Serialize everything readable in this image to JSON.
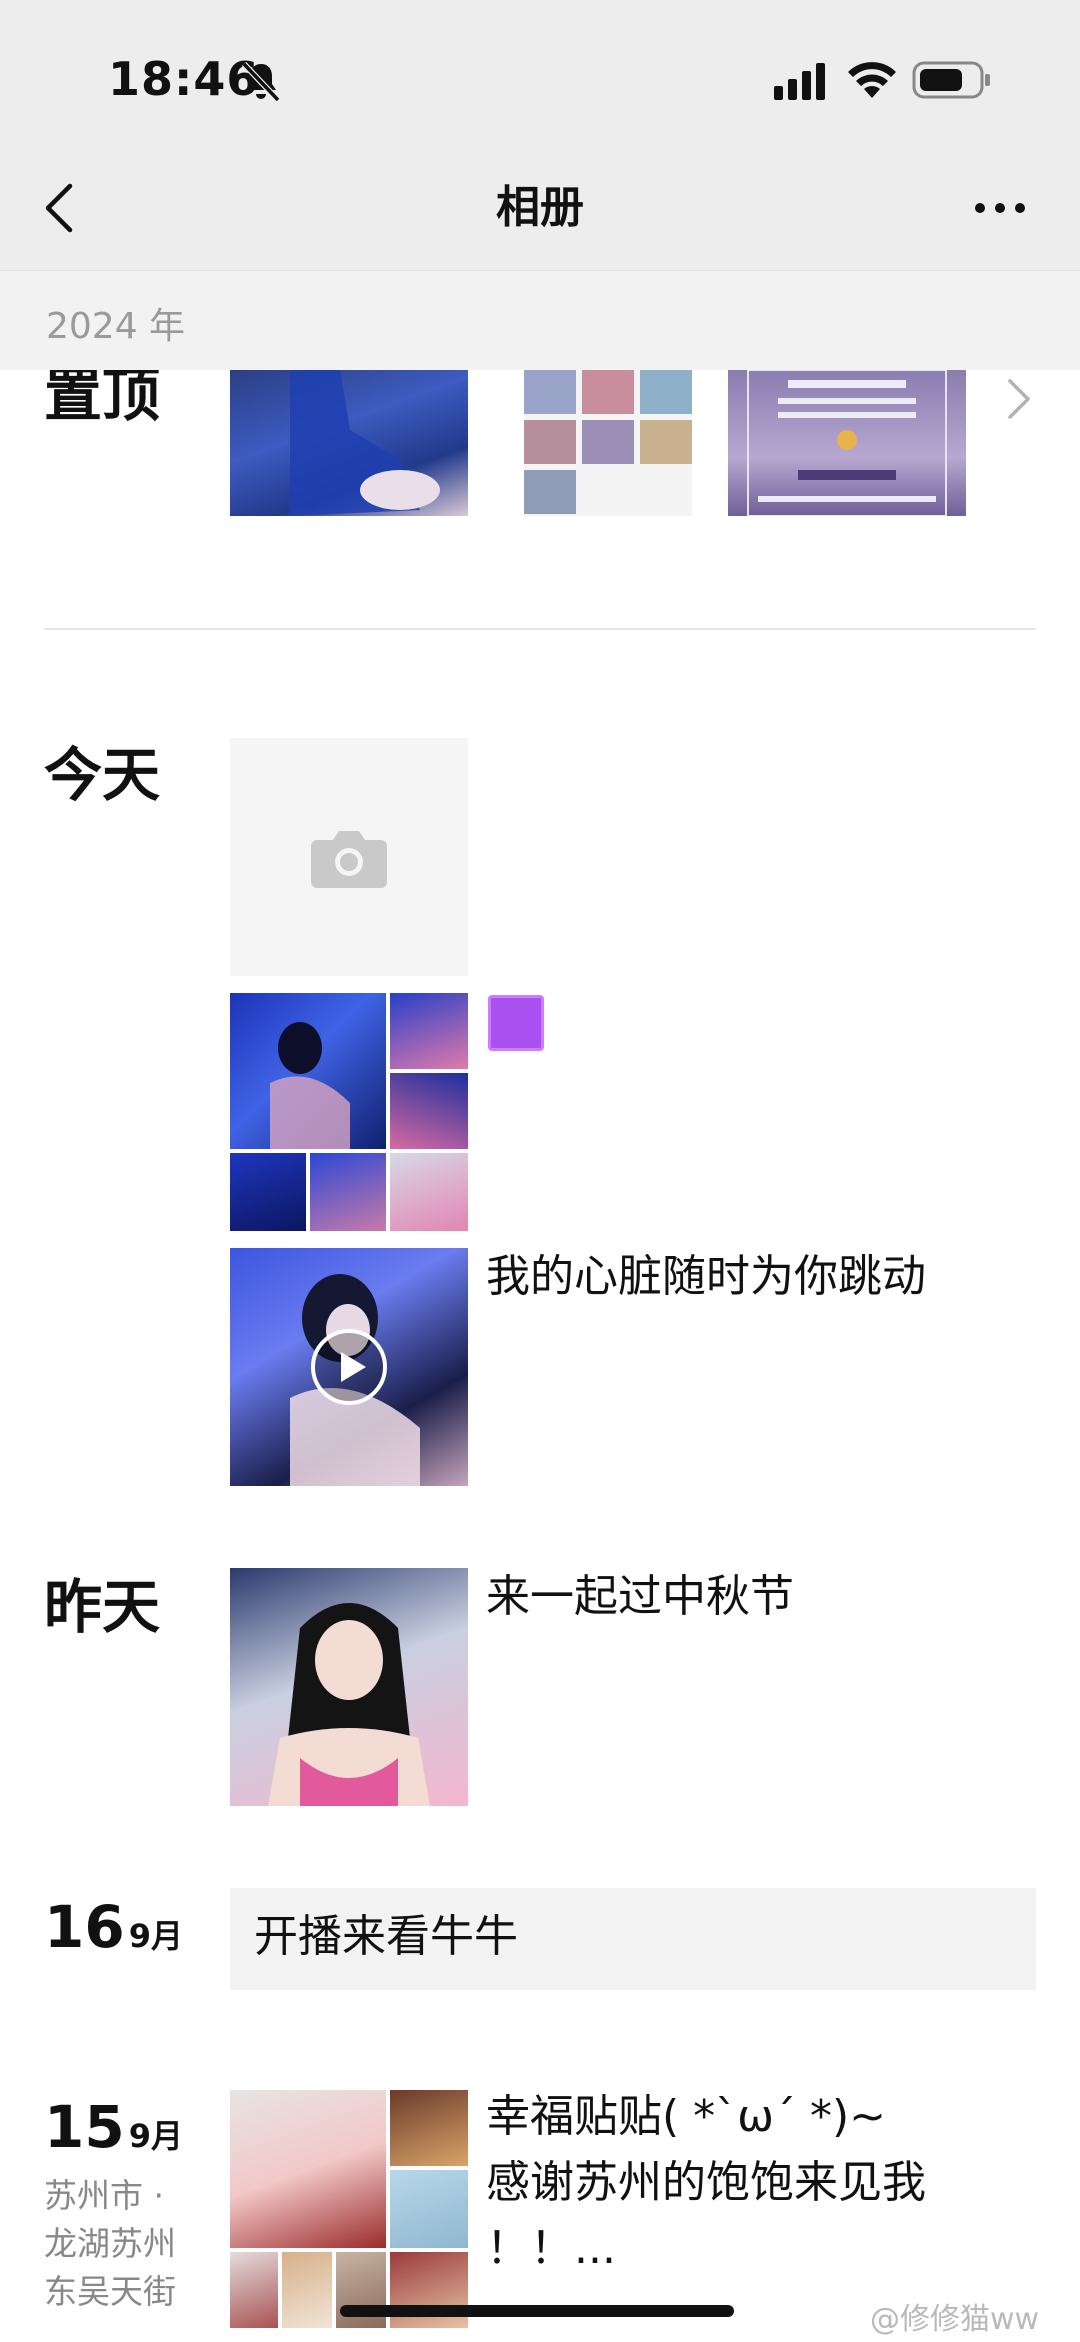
{
  "status_bar": {
    "time": "18:46"
  },
  "nav": {
    "title": "相册"
  },
  "year_bar": {
    "label": "2024 年"
  },
  "pinned": {
    "label": "置顶"
  },
  "groups": {
    "today": "今天",
    "yesterday": "昨天",
    "d16": {
      "day": "16",
      "month": "9月"
    },
    "d15": {
      "day": "15",
      "month": "9月",
      "location": "苏州市 · 龙湖苏州东吴天街"
    }
  },
  "posts": {
    "heart": "我的心脏随时为你跳动",
    "midautumn": "来一起过中秋节",
    "stream": "开播来看牛牛",
    "happy_line1": "幸福贴贴( *`ω´ *)~",
    "happy_line2": "感谢苏州的饱饱来见我",
    "happy_line3": "！！..."
  },
  "watermark": "@修修猫ww",
  "colors": {
    "nav_bg": "#ededed",
    "text_card_bg": "#f3f3f3",
    "purple_block": "#a84ff0"
  }
}
